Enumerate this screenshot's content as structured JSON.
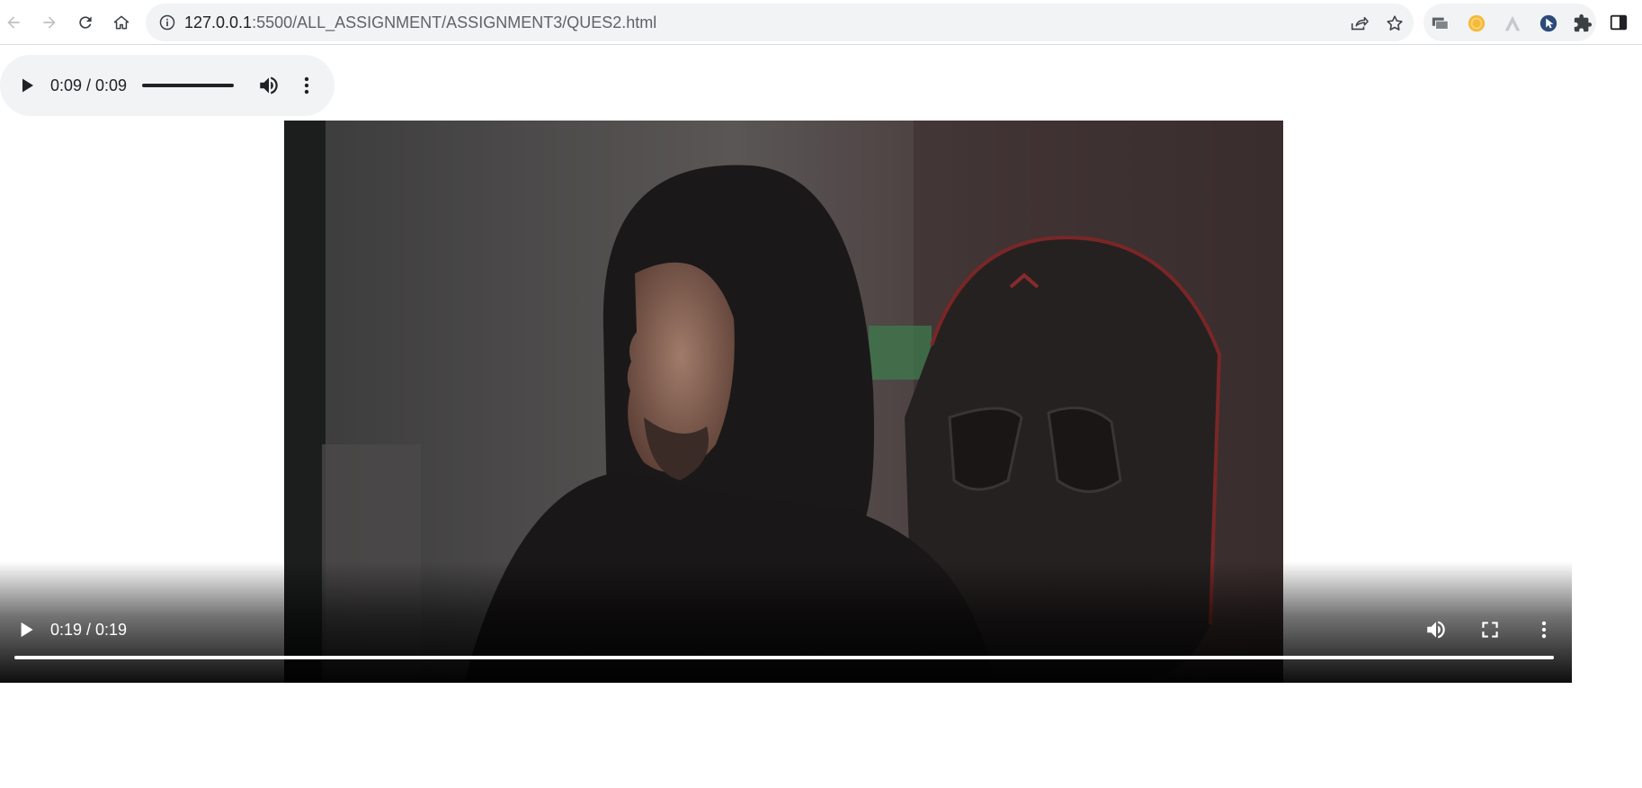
{
  "browser": {
    "url_host": "127.0.0.1",
    "url_path": ":5500/ALL_ASSIGNMENT/ASSIGNMENT3/QUES2.html",
    "icons": {
      "back": "arrow-left-icon",
      "forward": "arrow-right-icon",
      "reload": "reload-icon",
      "home": "home-icon",
      "site_info": "info-icon",
      "share": "share-icon",
      "bookmark": "star-icon",
      "extensions": [
        "tab-manager-extension-icon",
        "orange-extension-icon",
        "triangle-extension-icon",
        "cursor-extension-icon",
        "puzzle-icon"
      ],
      "side_panel": "side-panel-icon"
    }
  },
  "audio_player": {
    "time": "0:09 / 0:09",
    "progress": 1.0,
    "icons": {
      "play": "play-icon",
      "volume": "volume-icon",
      "more": "more-vertical-icon"
    }
  },
  "video_player": {
    "time": "0:19 / 0:19",
    "progress": 1.0,
    "icons": {
      "play": "play-icon",
      "volume": "volume-icon",
      "fullscreen": "fullscreen-icon",
      "more": "more-vertical-icon"
    }
  },
  "colors": {
    "chrome_bg": "#f1f3f4",
    "text": "#202124",
    "video_overlay": "#000000",
    "progress_fill": "#ffffff"
  }
}
